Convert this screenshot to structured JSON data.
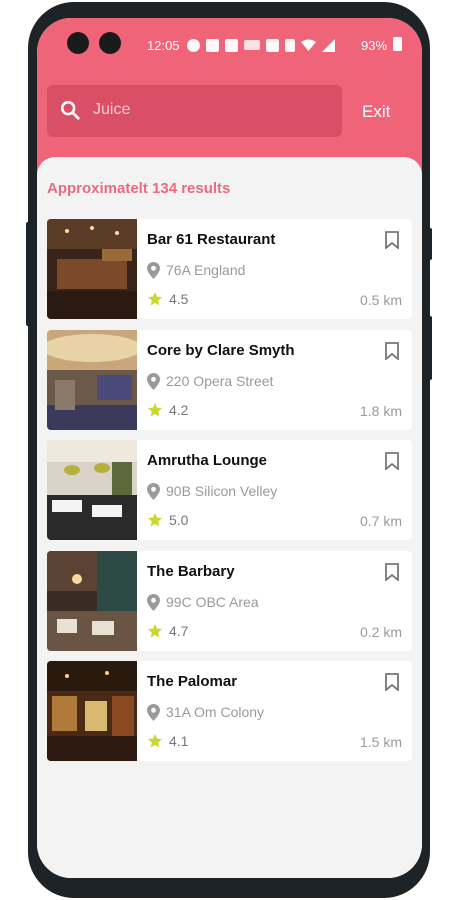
{
  "status_bar": {
    "time": "12:05",
    "battery": "93%"
  },
  "search": {
    "value": "Juice"
  },
  "header": {
    "exit_label": "Exit"
  },
  "results_text": "Approximatelt 134 results",
  "restaurants": [
    {
      "name": "Bar 61 Restaurant",
      "address": "76A England",
      "rating": "4.5",
      "distance": "0.5 km"
    },
    {
      "name": "Core by Clare Smyth",
      "address": "220 Opera Street",
      "rating": "4.2",
      "distance": "1.8 km"
    },
    {
      "name": "Amrutha Lounge",
      "address": "90B Silicon Velley",
      "rating": "5.0",
      "distance": "0.7 km"
    },
    {
      "name": "The Barbary",
      "address": "99C OBC Area",
      "rating": "4.7",
      "distance": "0.2 km"
    },
    {
      "name": "The Palomar",
      "address": "31A Om Colony",
      "rating": "4.1",
      "distance": "1.5 km"
    }
  ],
  "colors": {
    "header": "#f0647a",
    "search_bg": "#d94f65",
    "results_text": "#ea6a80",
    "star": "#c9d82f"
  }
}
